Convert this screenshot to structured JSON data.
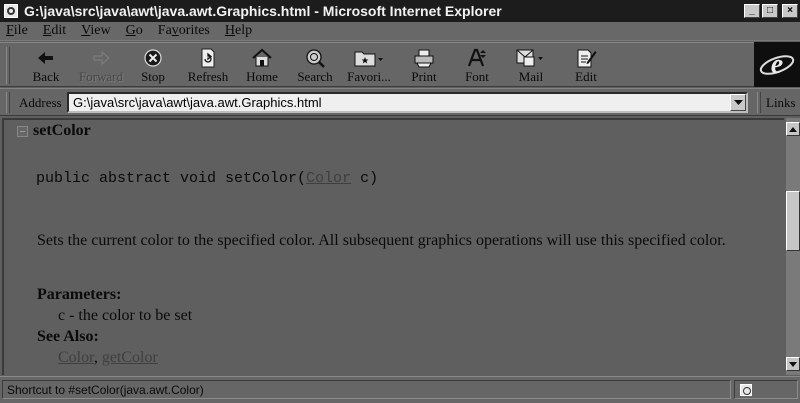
{
  "window": {
    "title": "G:\\java\\src\\java\\awt\\java.awt.Graphics.html - Microsoft Internet Explorer",
    "controls": {
      "minimize": "_",
      "maximize": "□",
      "close": "×"
    }
  },
  "menubar": {
    "items": [
      {
        "accel": "F",
        "rest": "ile"
      },
      {
        "accel": "E",
        "rest": "dit"
      },
      {
        "accel": "V",
        "rest": "iew"
      },
      {
        "accel": "G",
        "rest": "o"
      },
      {
        "accel": "F",
        "rest": "a",
        "accel2": "v",
        "rest2": "orites"
      },
      {
        "accel": "H",
        "rest": "elp"
      }
    ]
  },
  "toolbar": {
    "buttons": [
      {
        "label": "Back",
        "icon": "back-arrow-icon",
        "enabled": true
      },
      {
        "label": "Forward",
        "icon": "forward-arrow-icon",
        "enabled": false
      },
      {
        "label": "Stop",
        "icon": "stop-icon",
        "enabled": true
      },
      {
        "label": "Refresh",
        "icon": "refresh-icon",
        "enabled": true
      },
      {
        "label": "Home",
        "icon": "home-icon",
        "enabled": true
      },
      {
        "label": "Search",
        "icon": "search-icon",
        "enabled": true
      },
      {
        "label": "Favori...",
        "icon": "favorites-icon",
        "enabled": true
      },
      {
        "label": "Print",
        "icon": "print-icon",
        "enabled": true
      },
      {
        "label": "Font",
        "icon": "font-icon",
        "enabled": true
      },
      {
        "label": "Mail",
        "icon": "mail-icon",
        "enabled": true
      },
      {
        "label": "Edit",
        "icon": "edit-icon",
        "enabled": true
      }
    ]
  },
  "addressbar": {
    "label": "Address",
    "value": "G:\\java\\src\\java\\awt\\java.awt.Graphics.html",
    "links_label": "Links"
  },
  "content": {
    "section_title": "setColor",
    "signature_prefix": "public abstract void setColor(",
    "signature_link": "Color",
    "signature_suffix": " c)",
    "description": "Sets the current color to the specified color. All subsequent graphics operations will use this specified color.",
    "parameters_heading": "Parameters:",
    "parameter_line": "c - the color to be set",
    "see_also_heading": "See Also:",
    "see_also_links": [
      "Color",
      "getColor"
    ],
    "see_also_sep": ", "
  },
  "statusbar": {
    "text": "Shortcut to #setColor(java.awt.Color)"
  }
}
